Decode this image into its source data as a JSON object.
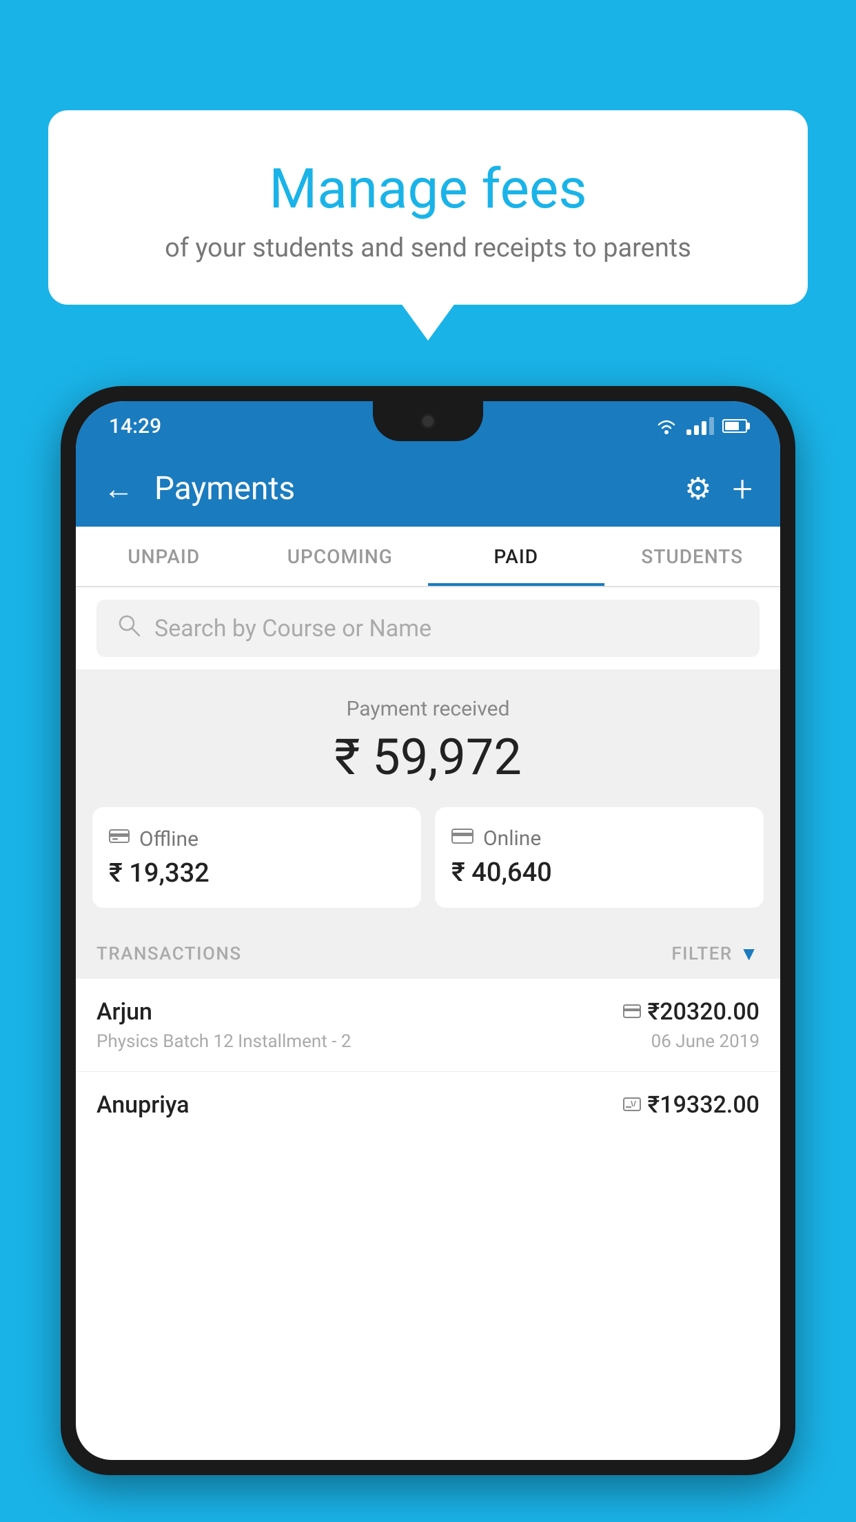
{
  "background_color": "#1ab3e8",
  "speech_bubble": {
    "title": "Manage fees",
    "subtitle": "of your students and send receipts to parents"
  },
  "status_bar": {
    "time": "14:29"
  },
  "header": {
    "title": "Payments",
    "back_label": "←",
    "gear_label": "⚙",
    "plus_label": "+"
  },
  "tabs": [
    {
      "id": "unpaid",
      "label": "UNPAID",
      "active": false
    },
    {
      "id": "upcoming",
      "label": "UPCOMING",
      "active": false
    },
    {
      "id": "paid",
      "label": "PAID",
      "active": true
    },
    {
      "id": "students",
      "label": "STUDENTS",
      "active": false
    }
  ],
  "search": {
    "placeholder": "Search by Course or Name"
  },
  "payment_received": {
    "label": "Payment received",
    "amount": "₹ 59,972"
  },
  "payment_cards": [
    {
      "id": "offline",
      "icon": "🧾",
      "label": "Offline",
      "amount": "₹ 19,332"
    },
    {
      "id": "online",
      "icon": "💳",
      "label": "Online",
      "amount": "₹ 40,640"
    }
  ],
  "transactions_label": "TRANSACTIONS",
  "filter_label": "FILTER",
  "transactions": [
    {
      "name": "Arjun",
      "detail": "Physics Batch 12 Installment - 2",
      "payment_type": "online",
      "amount": "₹20320.00",
      "date": "06 June 2019"
    },
    {
      "name": "Anupriya",
      "detail": "",
      "payment_type": "offline",
      "amount": "₹19332.00",
      "date": ""
    }
  ]
}
